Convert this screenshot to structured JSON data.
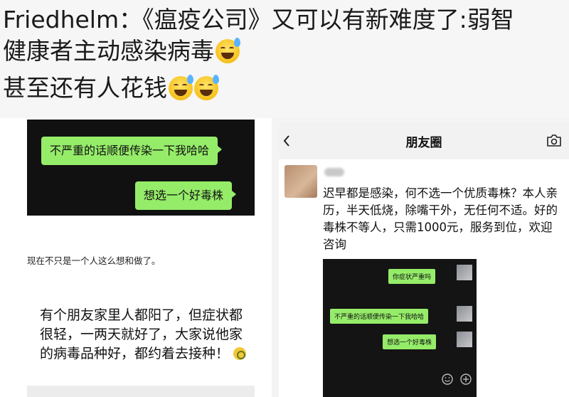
{
  "caption": {
    "line1": "Friedhelm：《瘟疫公司》又可以有新难度了:弱智",
    "line2": "健康者主动感染病毒",
    "line3": "甚至还有人花钱"
  },
  "left_panel": {
    "bubble1": "不严重的话顺便传染一下我哈哈",
    "bubble2": "想选一个好毒株",
    "small_text": "现在不只是一个人这么想和做了。",
    "main_text": "有个朋友家里人都阳了，但症状都很轻，一两天就好了，大家说他家的病毒品种好，都约着去接种！"
  },
  "moments": {
    "title": "朋友圈",
    "post_text": "迟早都是感染，何不选一个优质毒株？本人亲历，半天低烧，除嘴干外，无任何不适。好的毒株不等人，只需1000元，服务到位，欢迎咨询",
    "screenshot_bubbles": [
      "你症状严重吗",
      "不严重的话顺便传染一下我哈哈",
      "想选一个好毒株"
    ]
  },
  "colors": {
    "wechat_green": "#95ec69",
    "chat_background": "#111111",
    "page_background": "#f4f4f4"
  },
  "icons": [
    "grinning-sweat-emoji-icon",
    "back-chevron-icon",
    "camera-icon",
    "emoji-icon",
    "plus-icon"
  ]
}
